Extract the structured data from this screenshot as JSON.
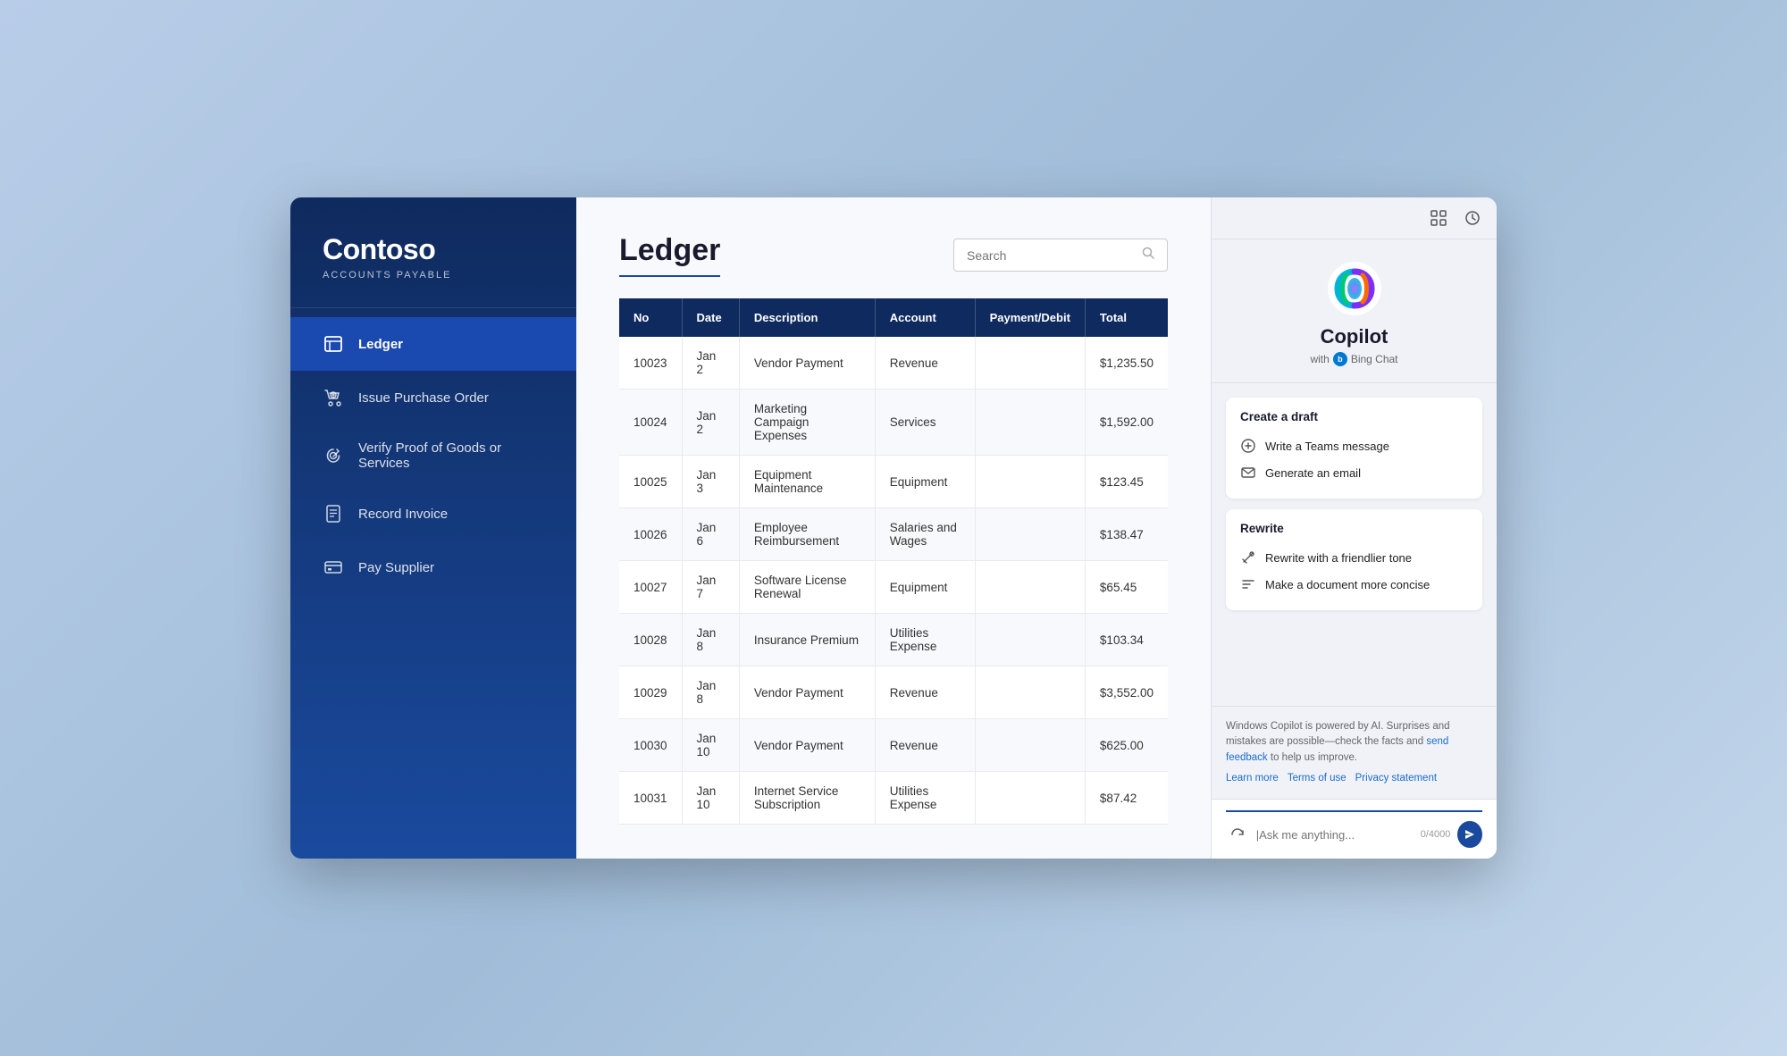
{
  "app": {
    "brand": "Contoso",
    "subtitle": "ACCOUNTS PAYABLE"
  },
  "sidebar": {
    "items": [
      {
        "id": "ledger",
        "label": "Ledger",
        "active": true
      },
      {
        "id": "purchase-order",
        "label": "Issue Purchase Order",
        "active": false
      },
      {
        "id": "verify-proof",
        "label": "Verify Proof of Goods or Services",
        "active": false
      },
      {
        "id": "record-invoice",
        "label": "Record Invoice",
        "active": false
      },
      {
        "id": "pay-supplier",
        "label": "Pay Supplier",
        "active": false
      }
    ]
  },
  "main": {
    "page_title": "Ledger",
    "search_placeholder": "Search",
    "table": {
      "headers": [
        "No",
        "Date",
        "Description",
        "Account",
        "Payment/Debit",
        "Total"
      ],
      "rows": [
        {
          "no": "10023",
          "date": "Jan 2",
          "description": "Vendor Payment",
          "account": "Revenue",
          "payment_debit": "",
          "total": "$1,235.50"
        },
        {
          "no": "10024",
          "date": "Jan 2",
          "description": "Marketing Campaign Expenses",
          "account": "Services",
          "payment_debit": "",
          "total": "$1,592.00"
        },
        {
          "no": "10025",
          "date": "Jan 3",
          "description": "Equipment Maintenance",
          "account": "Equipment",
          "payment_debit": "",
          "total": "$123.45"
        },
        {
          "no": "10026",
          "date": "Jan 6",
          "description": "Employee Reimbursement",
          "account": "Salaries and Wages",
          "payment_debit": "",
          "total": "$138.47"
        },
        {
          "no": "10027",
          "date": "Jan 7",
          "description": "Software License Renewal",
          "account": "Equipment",
          "payment_debit": "",
          "total": "$65.45"
        },
        {
          "no": "10028",
          "date": "Jan 8",
          "description": "Insurance Premium",
          "account": "Utilities Expense",
          "payment_debit": "",
          "total": "$103.34"
        },
        {
          "no": "10029",
          "date": "Jan 8",
          "description": "Vendor Payment",
          "account": "Revenue",
          "payment_debit": "",
          "total": "$3,552.00"
        },
        {
          "no": "10030",
          "date": "Jan 10",
          "description": "Vendor Payment",
          "account": "Revenue",
          "payment_debit": "",
          "total": "$625.00"
        },
        {
          "no": "10031",
          "date": "Jan 10",
          "description": "Internet Service Subscription",
          "account": "Utilities Expense",
          "payment_debit": "",
          "total": "$87.42"
        }
      ]
    }
  },
  "copilot": {
    "title": "Copilot",
    "subtitle": "with",
    "bing_label": "B",
    "bing_text": "Bing Chat",
    "create_draft_title": "Create a draft",
    "teams_message_label": "Write a Teams message",
    "email_label": "Generate an email",
    "rewrite_title": "Rewrite",
    "rewrite_tone_label": "Rewrite with a friendlier tone",
    "rewrite_concise_label": "Make a document more concise",
    "footer_text": "Windows Copilot is powered by AI. Surprises and mistakes are possible—check the facts and",
    "footer_link_text": "send feedback",
    "footer_suffix": "to help us improve.",
    "footer_links": [
      "Learn more",
      "Terms of use",
      "Privacy statement"
    ],
    "input_placeholder": "|Ask me anything...",
    "char_count": "0/4000"
  }
}
